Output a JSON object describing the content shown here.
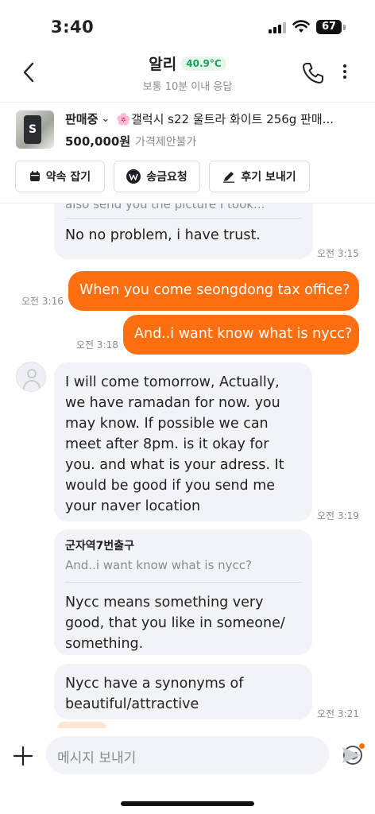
{
  "status_bar": {
    "time": "3:40",
    "battery": "67"
  },
  "header": {
    "title": "알리",
    "temperature": "40.9°C",
    "subtitle": "보통 10분 이내 응답"
  },
  "product": {
    "status": "판매중",
    "title": "🌸갤럭시 s22 울트라 화이트 256g 판매...",
    "price": "500,000원",
    "negotiation": "가격제안불가",
    "thumb_letter": "S"
  },
  "actions": [
    {
      "label": "약속 잡기",
      "icon": "calendar-icon"
    },
    {
      "label": "송금요청",
      "icon": "won-icon"
    },
    {
      "label": "후기 보내기",
      "icon": "pencil-icon"
    }
  ],
  "messages": [
    {
      "type": "in",
      "quote_cut": "also send you the picture I took...",
      "text": "No no problem, i have trust.",
      "time": "오전 3:15"
    },
    {
      "type": "out",
      "text": "When you come seongdong tax office?",
      "time": "오전 3:16"
    },
    {
      "type": "out",
      "text": "And..i want know what is nycc?",
      "time": "오전 3:18"
    },
    {
      "type": "in",
      "text": "I will come tomorrow, Actually, we have ramadan for now. you may know. If possible we can meet after 8pm. is it okay for you. and what is your adress. It would be good if you send me your naver location",
      "time": "오전 3:19"
    },
    {
      "type": "in",
      "reply_to_name": "군자역7번출구",
      "reply_to_text": "And..i want know what is nycc?",
      "text": "Nycc means something very good, that you like in someone/ something."
    },
    {
      "type": "in",
      "text": "Nycc have a synonyms of beautiful/attractive",
      "time": "오전 3:21"
    }
  ],
  "input": {
    "placeholder": "메시지 보내기"
  },
  "colors": {
    "accent": "#ff6f0f",
    "temperature": "#1fa055",
    "bubble_in": "#f2f3f6"
  }
}
